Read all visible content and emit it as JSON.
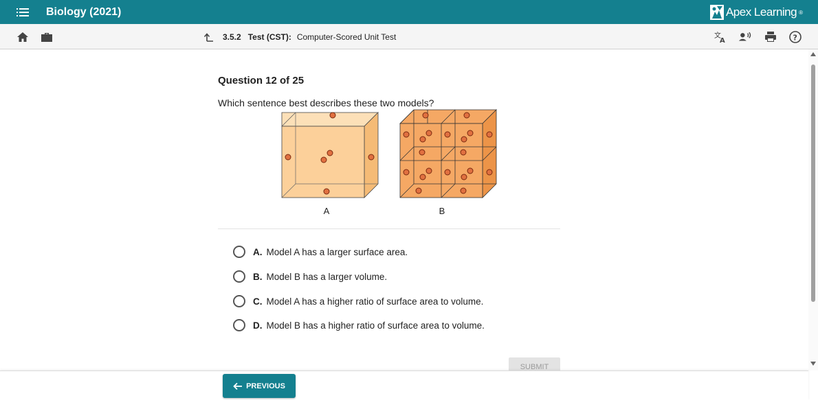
{
  "header": {
    "course_title": "Biology (2021)",
    "brand": "Apex Learning",
    "brand_mark": "®",
    "bar_color": "#14808f"
  },
  "toolbar": {
    "icons": [
      "home-icon",
      "briefcase-icon",
      "up-arrow-icon",
      "translate-icon",
      "read-aloud-icon",
      "print-icon",
      "help-icon"
    ],
    "lesson_number": "3.5.2",
    "lesson_type": "Test (CST):",
    "lesson_name": "Computer-Scored Unit Test"
  },
  "question": {
    "title": "Question 12 of 25",
    "text": "Which sentence best describes these two models?",
    "figure_labels": [
      "A",
      "B"
    ],
    "choices": [
      {
        "letter": "A.",
        "text": "Model A has a larger surface area."
      },
      {
        "letter": "B.",
        "text": "Model B has a larger volume."
      },
      {
        "letter": "C.",
        "text": "Model A has a higher ratio of surface area to volume."
      },
      {
        "letter": "D.",
        "text": "Model B has a higher ratio of surface area to volume."
      }
    ]
  },
  "actions": {
    "submit_label": "SUBMIT",
    "previous_label": "PREVIOUS"
  }
}
